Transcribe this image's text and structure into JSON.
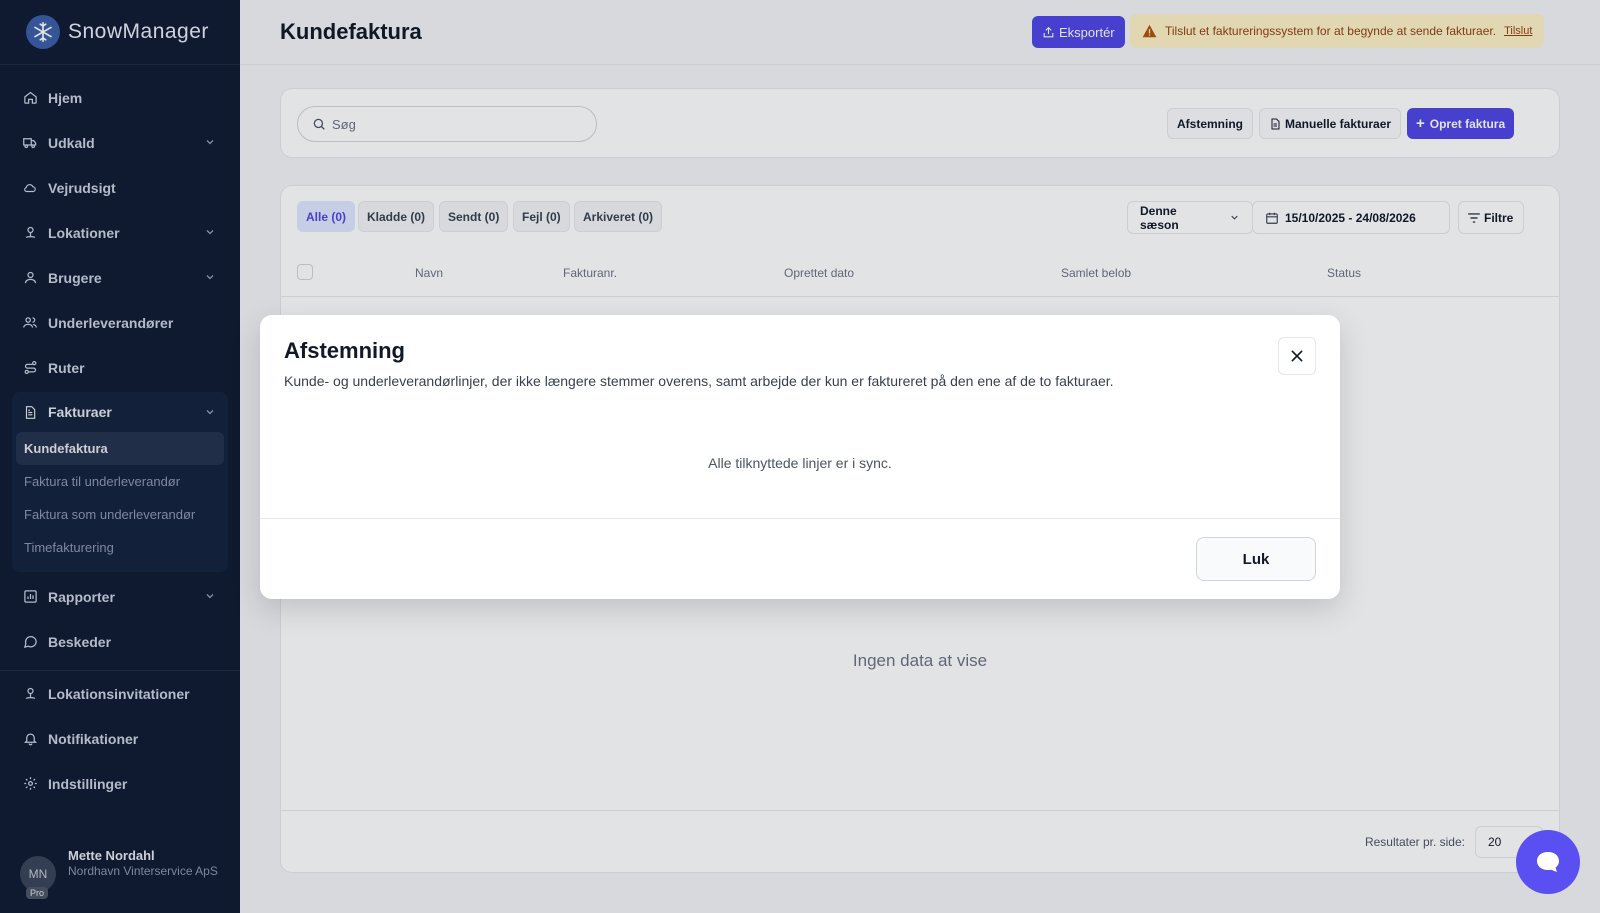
{
  "app": {
    "name": "SnowManager"
  },
  "sidebar": {
    "items": [
      {
        "label": "Hjem",
        "icon": "home-icon"
      },
      {
        "label": "Udkald",
        "icon": "truck-icon",
        "expandable": true
      },
      {
        "label": "Vejrudsigt",
        "icon": "cloud-icon"
      },
      {
        "label": "Lokationer",
        "icon": "location-icon",
        "expandable": true
      },
      {
        "label": "Brugere",
        "icon": "user-icon",
        "expandable": true
      },
      {
        "label": "Underleverandører",
        "icon": "users-icon"
      },
      {
        "label": "Ruter",
        "icon": "route-icon"
      }
    ],
    "invoices": {
      "label": "Fakturaer",
      "icon": "document-icon",
      "subitems": [
        {
          "label": "Kundefaktura",
          "active": true
        },
        {
          "label": "Faktura til underleverandør"
        },
        {
          "label": "Faktura som underleverandør"
        },
        {
          "label": "Timefakturering"
        }
      ]
    },
    "after": [
      {
        "label": "Rapporter",
        "icon": "chart-icon",
        "expandable": true
      },
      {
        "label": "Beskeder",
        "icon": "message-icon"
      }
    ],
    "bottom": [
      {
        "label": "Lokationsinvitationer",
        "icon": "location-icon"
      },
      {
        "label": "Notifikationer",
        "icon": "bell-icon"
      },
      {
        "label": "Indstillinger",
        "icon": "gear-icon"
      }
    ],
    "user": {
      "initials": "MN",
      "badge": "Pro",
      "name": "Mette Nordahl",
      "org": "Nordhavn Vinterservice ApS"
    }
  },
  "header": {
    "title": "Kundefaktura",
    "export_label": "Eksportér",
    "warning_text": "Tilslut et faktureringssystem for at begynde at sende fakturaer.",
    "warning_link": "Tilslut"
  },
  "toolbar": {
    "search_placeholder": "Søg",
    "reconcile_label": "Afstemning",
    "manual_label": "Manuelle fakturaer",
    "create_label": "Opret faktura"
  },
  "tabs": [
    {
      "label": "Alle (0)",
      "active": true
    },
    {
      "label": "Kladde (0)"
    },
    {
      "label": "Sendt (0)"
    },
    {
      "label": "Fejl (0)"
    },
    {
      "label": "Arkiveret (0)"
    }
  ],
  "filters": {
    "season": "Denne sæson",
    "date_range": "15/10/2025 - 24/08/2026",
    "filter_label": "Filtre"
  },
  "table": {
    "columns": [
      "Navn",
      "Fakturanr.",
      "Oprettet dato",
      "Samlet belob",
      "Status"
    ],
    "empty": "Ingen data at vise",
    "per_page_label": "Resultater pr. side:",
    "per_page_value": "20"
  },
  "modal": {
    "title": "Afstemning",
    "description": "Kunde- og underleverandørlinjer, der ikke længere stemmer overens, samt arbejde der kun er faktureret på den ene af de to fakturaer.",
    "message": "Alle tilknyttede linjer er i sync.",
    "close_label": "Luk"
  },
  "colors": {
    "sidebar_bg": "#0f1b33",
    "accent": "#4f46e5",
    "chat": "#5a4ff0",
    "warning_bg": "#fef3c7"
  }
}
